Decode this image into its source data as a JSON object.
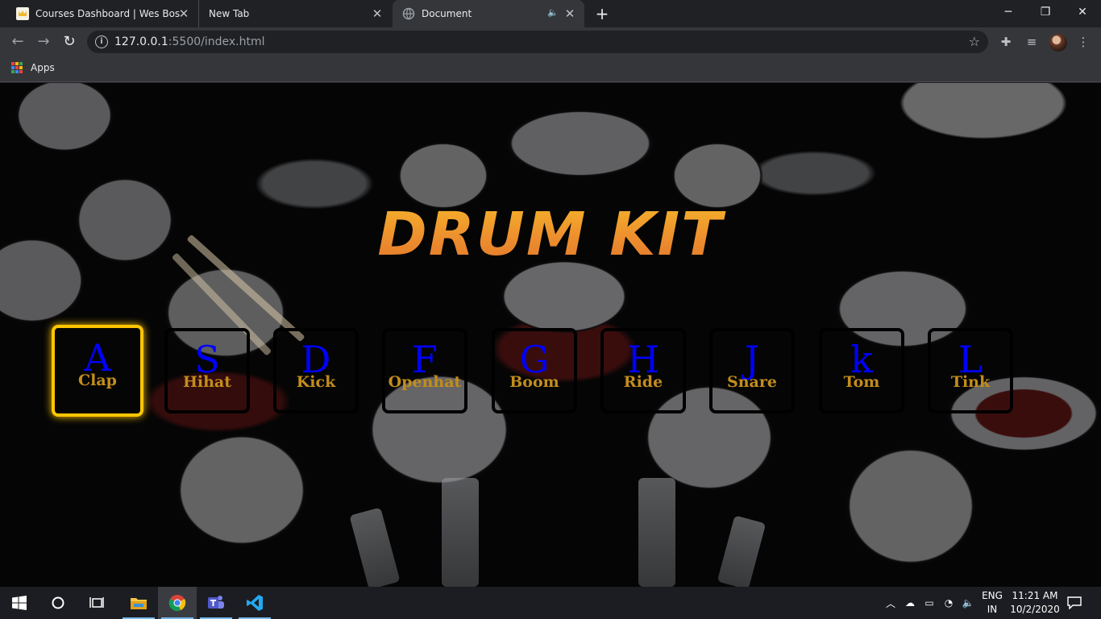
{
  "browser": {
    "tabs": [
      {
        "title": "Courses Dashboard | Wes Bos",
        "favicon": "crown-icon",
        "active": false
      },
      {
        "title": "New Tab",
        "favicon": "",
        "active": false
      },
      {
        "title": "Document",
        "favicon": "globe-icon",
        "active": true,
        "audio": true
      }
    ],
    "url_host": "127.0.0.1",
    "url_rest": ":5500/index.html",
    "bookmarks": {
      "apps_label": "Apps"
    }
  },
  "page": {
    "title": "DRUM KIT",
    "keys": [
      {
        "letter": "A",
        "sound": "Clap",
        "playing": true
      },
      {
        "letter": "S",
        "sound": "Hihat",
        "playing": false
      },
      {
        "letter": "D",
        "sound": "Kick",
        "playing": false
      },
      {
        "letter": "F",
        "sound": "Openhat",
        "playing": false
      },
      {
        "letter": "G",
        "sound": "Boom",
        "playing": false
      },
      {
        "letter": "H",
        "sound": "Ride",
        "playing": false
      },
      {
        "letter": "J",
        "sound": "Snare",
        "playing": false
      },
      {
        "letter": "k",
        "sound": "Tom",
        "playing": false
      },
      {
        "letter": "L",
        "sound": "Tink",
        "playing": false
      }
    ],
    "colors": {
      "title": "#f0a32c",
      "letter": "#0000ff",
      "sound": "#c38d1b",
      "playing_border": "#ffc600"
    }
  },
  "taskbar": {
    "apps": [
      "start-icon",
      "search-icon",
      "task-view-icon",
      "file-explorer-icon",
      "chrome-icon",
      "teams-icon",
      "vscode-icon"
    ],
    "lang_line1": "ENG",
    "lang_line2": "IN",
    "time": "11:21 AM",
    "date": "10/2/2020"
  }
}
